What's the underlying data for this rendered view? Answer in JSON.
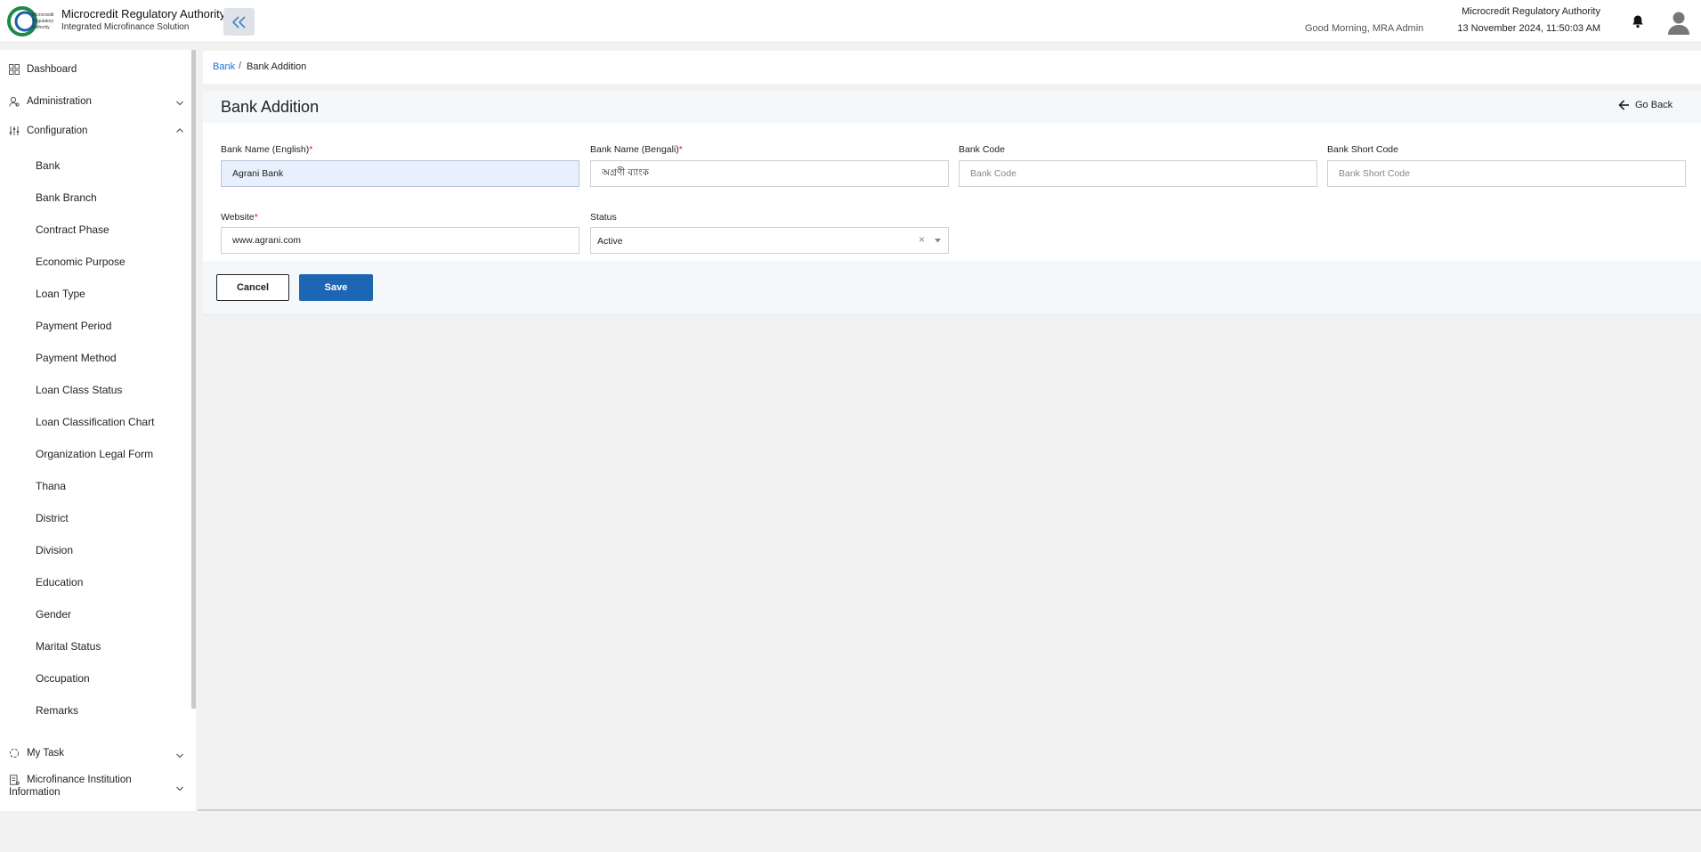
{
  "header": {
    "app_title": "Microcredit Regulatory Authority",
    "app_subtitle": "Integrated Microfinance Solution",
    "logo_text": "Microcredit Regulatory Authority",
    "greeting": "Good Morning, MRA Admin",
    "org_name": "Microcredit Regulatory Authority",
    "datetime": "13 November 2024, 11:50:03 AM",
    "collapse_icon": "double-chevron-left-icon",
    "bell_icon": "bell-icon",
    "avatar_icon": "user-avatar-icon"
  },
  "sidebar": {
    "dashboard": "Dashboard",
    "administration": "Administration",
    "configuration": "Configuration",
    "config_items": [
      "Bank",
      "Bank Branch",
      "Contract Phase",
      "Economic Purpose",
      "Loan Type",
      "Payment Period",
      "Payment Method",
      "Loan Class Status",
      "Loan Classification Chart",
      "Organization Legal Form",
      "Thana",
      "District",
      "Division",
      "Education",
      "Gender",
      "Marital Status",
      "Occupation",
      "Remarks"
    ],
    "my_task": "My Task",
    "mfi_info_line1": "Microfinance Institution",
    "mfi_info_line2": "Information"
  },
  "breadcrumb": {
    "parent": "Bank",
    "separator": "/",
    "current": "Bank Addition"
  },
  "page": {
    "title": "Bank Addition",
    "go_back": "Go Back"
  },
  "form": {
    "bank_name_en_label": "Bank Name (English)",
    "bank_name_en_value": "Agrani Bank",
    "bank_name_bn_label": "Bank Name (Bengali)",
    "bank_name_bn_value": "অগ্রণী ব্যাংক",
    "bank_code_label": "Bank Code",
    "bank_code_placeholder": "Bank Code",
    "bank_short_code_label": "Bank Short Code",
    "bank_short_code_placeholder": "Bank Short Code",
    "website_label": "Website",
    "website_value": "www.agrani.com",
    "status_label": "Status",
    "status_value": "Active",
    "status_clear": "×",
    "required_mark": "*"
  },
  "actions": {
    "cancel": "Cancel",
    "save": "Save"
  },
  "colors": {
    "primary": "#1d66b3",
    "link": "#1e6fd9",
    "required": "#d0202a",
    "filled_input": "#e8f0fe"
  }
}
